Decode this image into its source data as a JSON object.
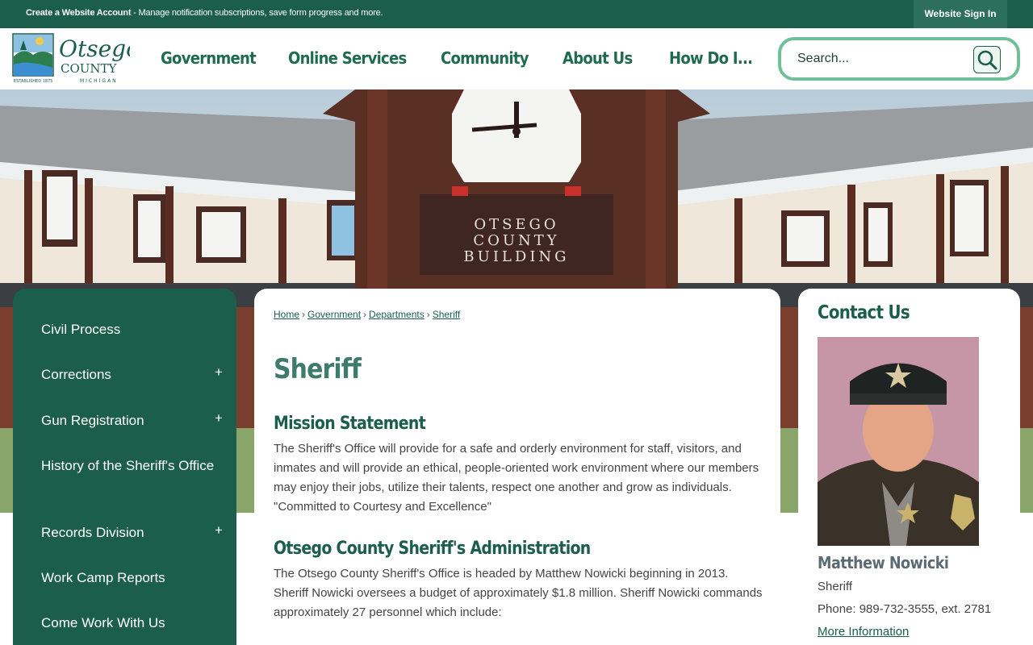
{
  "topbar": {
    "account_bold": "Create a Website Account",
    "account_text": " - Manage notification subscriptions, save form progress and more.",
    "signin": "Website Sign In"
  },
  "header": {
    "logo_text": "Otsego",
    "logo_sub": "COUNTY",
    "logo_state": "MICHIGAN",
    "logo_est": "ESTABLISHED 1875",
    "nav": [
      "Government",
      "Online Services",
      "Community",
      "About Us",
      "How Do I..."
    ],
    "search_placeholder": "Search..."
  },
  "hero": {
    "sign_line1": "OTSEGO",
    "sign_line2": "COUNTY",
    "sign_line3": "BUILDING"
  },
  "sidebar": {
    "items": [
      {
        "label": "Civil Process",
        "expandable": false
      },
      {
        "label": "Corrections",
        "expandable": true
      },
      {
        "label": "Gun Registration",
        "expandable": true
      },
      {
        "label": "History of the Sheriff's Office",
        "expandable": false
      },
      {
        "label": "Records Division",
        "expandable": true
      },
      {
        "label": "Work Camp Reports",
        "expandable": false
      },
      {
        "label": "Come Work With Us",
        "expandable": false
      }
    ],
    "expand_symbol": "+"
  },
  "main": {
    "breadcrumb": [
      "Home",
      "Government",
      "Departments",
      "Sheriff"
    ],
    "breadcrumb_sep": "›",
    "title": "Sheriff",
    "mission_heading": "Mission Statement",
    "mission_text": "The Sheriff's Office will provide for a safe and orderly environment for staff, visitors, and inmates and will provide an ethical, people-oriented work environment where our members may enjoy their jobs, utilize their talents, respect one another and grow as individuals. \"Committed to Courtesy and Excellence\"",
    "admin_heading": "Otsego County Sheriff's Administration",
    "admin_text": "The Otsego County Sheriff's Office is headed by Matthew Nowicki beginning in 2013. Sheriff Nowicki oversees a budget of approximately $1.8 million. Sheriff Nowicki commands approximately 27 personnel which include:"
  },
  "contact": {
    "title": "Contact Us",
    "name": "Matthew Nowicki",
    "role": "Sheriff",
    "phone": "Phone: 989-732-3555, ext. 2781",
    "more": "More Information"
  },
  "colors": {
    "brand_green": "#1b5e4b",
    "accent_green": "#6fbf98",
    "title_green": "#3f7b6b"
  }
}
